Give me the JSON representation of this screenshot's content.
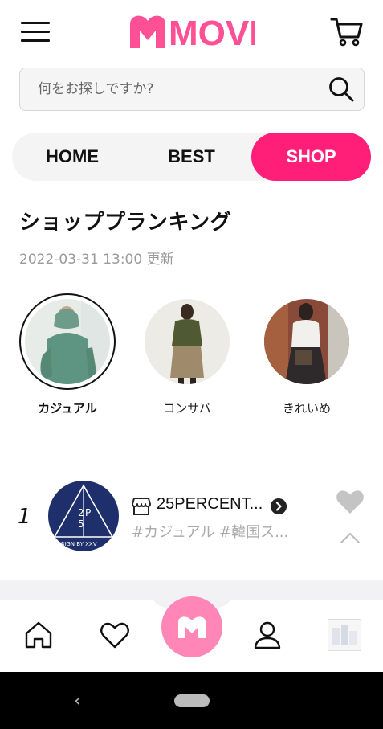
{
  "header": {
    "logo_text": "MOVE",
    "brand_color": "#ff4f95",
    "menu_icon": "hamburger-menu-icon",
    "cart_icon": "shopping-cart-icon"
  },
  "search": {
    "placeholder": "何をお探しですか?",
    "value": "",
    "icon": "search-icon"
  },
  "tabs": [
    {
      "label": "HOME",
      "active": false
    },
    {
      "label": "BEST",
      "active": false
    },
    {
      "label": "SHOP",
      "active": true
    }
  ],
  "accent_color": "#ff1f78",
  "section": {
    "title": "ショッププランキング",
    "updated": "2022-03-31 13:00 更新"
  },
  "categories": [
    {
      "label": "カジュアル",
      "active": true
    },
    {
      "label": "コンサバ",
      "active": false
    },
    {
      "label": "きれいめ",
      "active": false
    }
  ],
  "ranking": [
    {
      "rank": "1",
      "shop_name": "25PERCENT...",
      "tags": "#カジュアル  #韓国ス...",
      "logo_text": "DESIGN BY XXV"
    }
  ],
  "bottom_nav": {
    "items": [
      "home-icon",
      "heart-icon",
      "move-m-icon",
      "user-icon",
      "recent-item-thumbnail"
    ]
  },
  "system_nav": {
    "back_glyph": "‹"
  }
}
